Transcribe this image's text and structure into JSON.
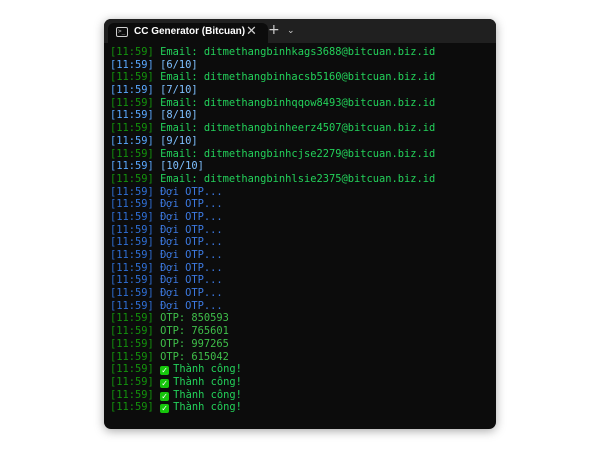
{
  "window": {
    "tab_title": "CC Generator (Bitcuan)",
    "tab_close_glyph": "✕",
    "new_tab_glyph": "+",
    "dropdown_glyph": "⌄"
  },
  "terminal": {
    "lines": [
      {
        "ts": "[11:59]",
        "text": "Email: ditmethangbinhkags3688@bitcuan.biz.id",
        "style": "email"
      },
      {
        "ts": "[11:59]",
        "text": "[6/10]",
        "style": "progress"
      },
      {
        "ts": "[11:59]",
        "text": "Email: ditmethangbinhacsb5160@bitcuan.biz.id",
        "style": "email"
      },
      {
        "ts": "[11:59]",
        "text": "[7/10]",
        "style": "progress"
      },
      {
        "ts": "[11:59]",
        "text": "Email: ditmethangbinhqqow8493@bitcuan.biz.id",
        "style": "email"
      },
      {
        "ts": "[11:59]",
        "text": "[8/10]",
        "style": "progress"
      },
      {
        "ts": "[11:59]",
        "text": "Email: ditmethangbinheerz4507@bitcuan.biz.id",
        "style": "email"
      },
      {
        "ts": "[11:59]",
        "text": "[9/10]",
        "style": "progress"
      },
      {
        "ts": "[11:59]",
        "text": "Email: ditmethangbinhcjse2279@bitcuan.biz.id",
        "style": "email"
      },
      {
        "ts": "[11:59]",
        "text": "[10/10]",
        "style": "progress"
      },
      {
        "ts": "[11:59]",
        "text": "Email: ditmethangbinhlsie2375@bitcuan.biz.id",
        "style": "email"
      },
      {
        "ts": "[11:59]",
        "text": "Đợi OTP...",
        "style": "wait"
      },
      {
        "ts": "[11:59]",
        "text": "Đợi OTP...",
        "style": "wait"
      },
      {
        "ts": "[11:59]",
        "text": "Đợi OTP...",
        "style": "wait"
      },
      {
        "ts": "[11:59]",
        "text": "Đợi OTP...",
        "style": "wait"
      },
      {
        "ts": "[11:59]",
        "text": "Đợi OTP...",
        "style": "wait"
      },
      {
        "ts": "[11:59]",
        "text": "Đợi OTP...",
        "style": "wait"
      },
      {
        "ts": "[11:59]",
        "text": "Đợi OTP...",
        "style": "wait"
      },
      {
        "ts": "[11:59]",
        "text": "Đợi OTP...",
        "style": "wait"
      },
      {
        "ts": "[11:59]",
        "text": "Đợi OTP...",
        "style": "wait"
      },
      {
        "ts": "[11:59]",
        "text": "Đợi OTP...",
        "style": "wait"
      },
      {
        "ts": "[11:59]",
        "text": "OTP: 850593",
        "style": "otp"
      },
      {
        "ts": "[11:59]",
        "text": "OTP: 765601",
        "style": "otp"
      },
      {
        "ts": "[11:59]",
        "text": "OTP: 997265",
        "style": "otp"
      },
      {
        "ts": "[11:59]",
        "text": "OTP: 615042",
        "style": "otp"
      },
      {
        "ts": "[11:59]",
        "text": "Thành công!",
        "style": "success"
      },
      {
        "ts": "[11:59]",
        "text": "Thành công!",
        "style": "success"
      },
      {
        "ts": "[11:59]",
        "text": "Thành công!",
        "style": "success"
      },
      {
        "ts": "[11:59]",
        "text": "Thành công!",
        "style": "success"
      }
    ]
  },
  "colors": {
    "background": "#0c0c0c",
    "tabbar": "#202020",
    "green": "#23d15a",
    "light_blue": "#7fc0ff",
    "blue": "#3c79e0"
  }
}
